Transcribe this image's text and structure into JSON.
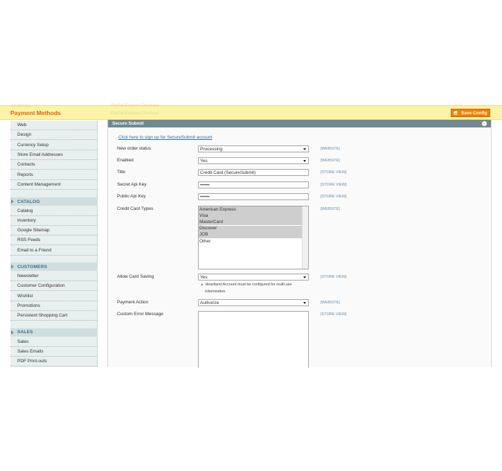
{
  "header": {
    "page_title": "Payment Methods",
    "save_label": "Save Config",
    "ghost_left": "GENERAL",
    "ghost_top": "PayPal Express Checkout",
    "ghost_bottom": "PayPal Express Checkout",
    "ghost_left_2": "SYSTEM"
  },
  "sidebar": {
    "items_top": [
      "Web",
      "Design",
      "Currency Setup",
      "Store Email Addresses",
      "Contacts",
      "Reports",
      "Content Management"
    ],
    "catalog": {
      "heading": "CATALOG",
      "items": [
        "Catalog",
        "Inventory",
        "Google Sitemap",
        "RSS Feeds",
        "Email to a Friend"
      ]
    },
    "customers": {
      "heading": "CUSTOMERS",
      "items": [
        "Newsletter",
        "Customer Configuration",
        "Wishlist",
        "Promotions",
        "Persistent Shopping Cart"
      ]
    },
    "sales": {
      "heading": "SALES",
      "items": [
        "Sales",
        "Sales Emails",
        "PDF Print-outs"
      ]
    }
  },
  "section": {
    "title": "Secure Submit",
    "signup_link": "Click here to sign up for SecureSubmit account"
  },
  "fields": {
    "order_status": {
      "label": "New order status",
      "value": "Processing",
      "scope": "[WEBSITE]"
    },
    "enabled": {
      "label": "Enabled",
      "value": "Yes",
      "scope": "[WEBSITE]"
    },
    "title": {
      "label": "Title",
      "value": "Credit Card (SecureSubmit)",
      "scope": "[STORE VIEW]"
    },
    "secret_key": {
      "label": "Secret Api Key",
      "value": "••••••",
      "scope": "[STORE VIEW]"
    },
    "public_key": {
      "label": "Public Api Key",
      "value": "••••••",
      "scope": "[STORE VIEW]"
    },
    "cc_types": {
      "label": "Credit Card Types",
      "scope": "[WEBSITE]",
      "options": [
        {
          "label": "American Express",
          "selected": true
        },
        {
          "label": "Visa",
          "selected": true
        },
        {
          "label": "MasterCard",
          "selected": true
        },
        {
          "label": "Discover",
          "selected": true
        },
        {
          "label": "JCB",
          "selected": true
        },
        {
          "label": "Other",
          "selected": false
        }
      ]
    },
    "card_saving": {
      "label": "Allow Card Saving",
      "value": "Yes",
      "scope": "[STORE VIEW]",
      "note_line1": "Heartland Account must be configured for multi-use",
      "note_line2": "tokenization."
    },
    "payment_action": {
      "label": "Payment Action",
      "value": "Authorize",
      "scope": "[WEBSITE]"
    },
    "error_message": {
      "label": "Custom Error Message",
      "value": "",
      "scope": "[STORE VIEW]"
    }
  }
}
